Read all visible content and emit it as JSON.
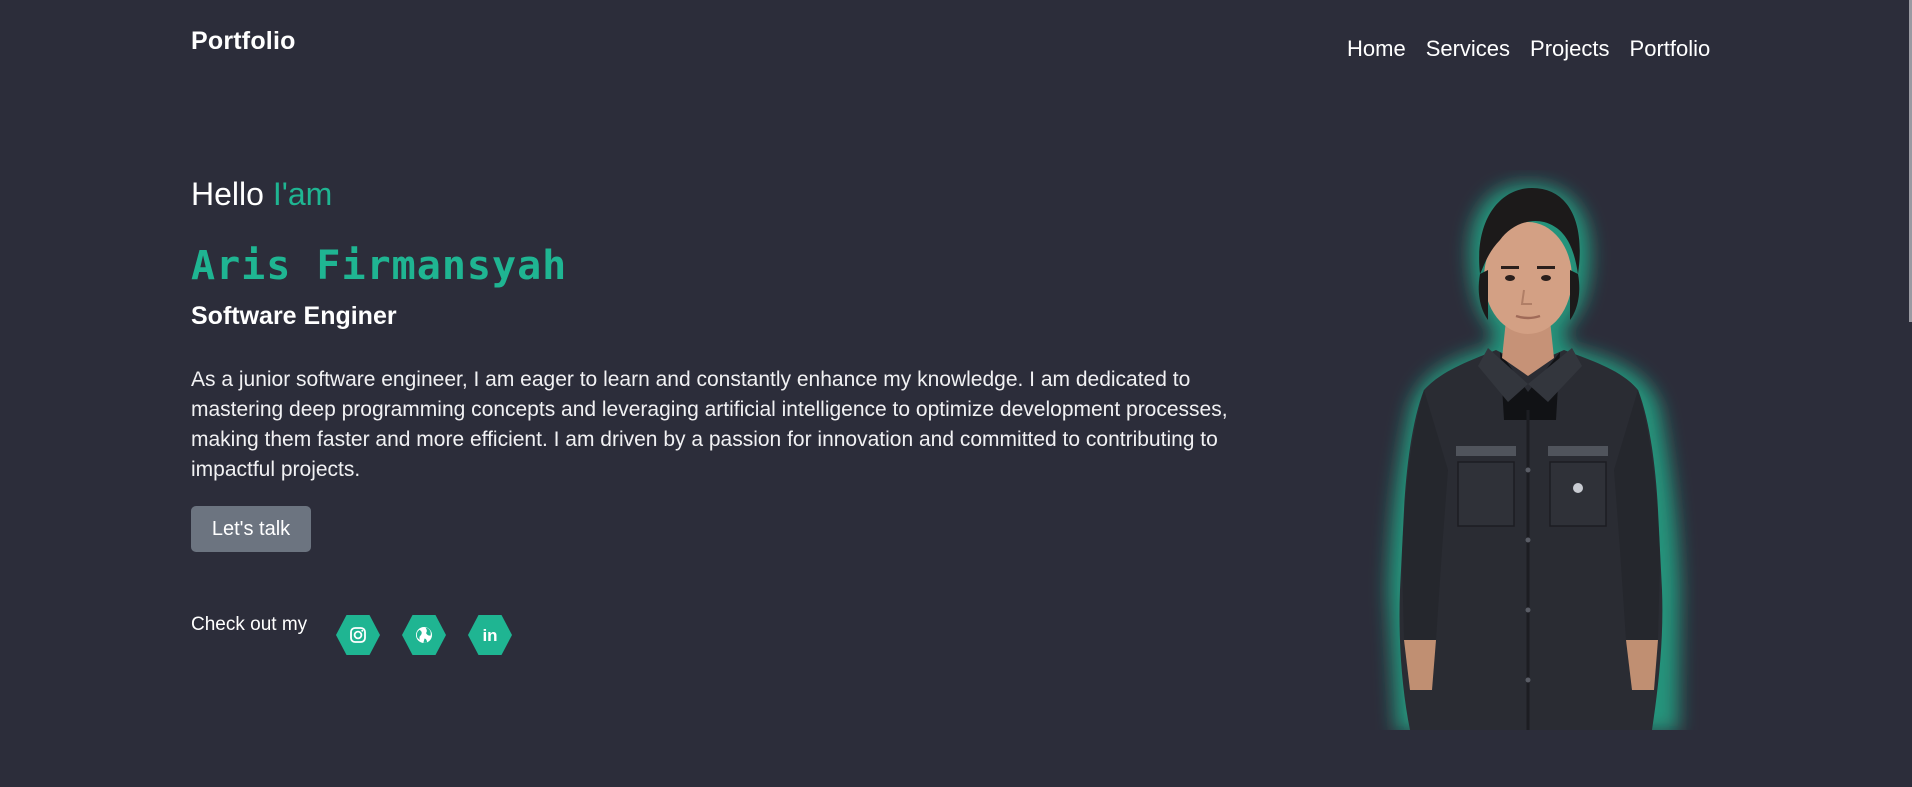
{
  "header": {
    "logo": "Portfolio",
    "nav": [
      "Home",
      "Services",
      "Projects",
      "Portfolio"
    ]
  },
  "hero": {
    "greeting_prefix": "Hello",
    "greeting_accent": "I'am",
    "name": "Aris Firmansyah",
    "role": "Software Enginer",
    "bio": "As a junior software engineer, I am eager to learn and constantly enhance my knowledge. I am dedicated to mastering deep programming concepts and leveraging artificial intelligence to optimize development processes, making them faster and more efficient. I am driven by a passion for innovation and committed to contributing to impactful projects.",
    "cta_label": "Let's talk"
  },
  "social": {
    "label": "Check out my",
    "icons": [
      "instagram-icon",
      "globe-icon",
      "linkedin-icon"
    ],
    "linkedin_text": "in"
  },
  "colors": {
    "background": "#2c2d3a",
    "accent": "#1fb592",
    "button": "#6c7480",
    "text": "#ffffff"
  }
}
